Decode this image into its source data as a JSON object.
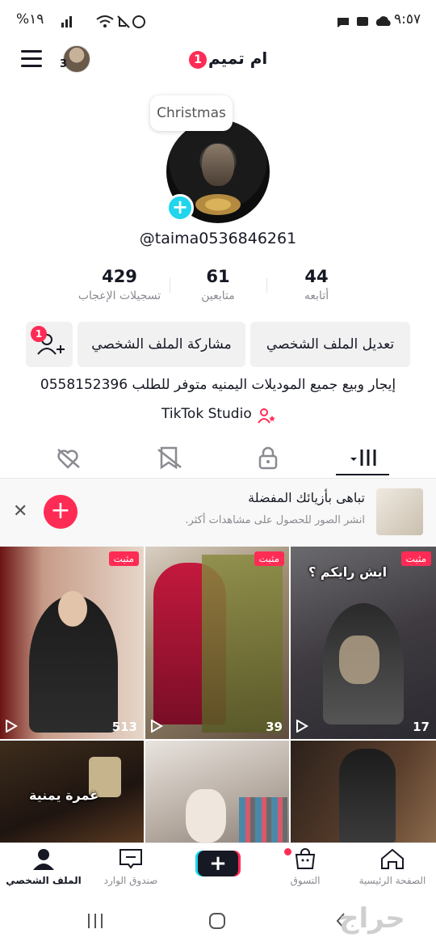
{
  "status_bar": {
    "time": "٩:٥٧",
    "battery": "%١٩"
  },
  "header": {
    "title": "ام تميم",
    "title_badge": "1",
    "avatar_count": "3"
  },
  "profile": {
    "note": "Christmas",
    "handle": "@taima0536846261",
    "stats": [
      {
        "value": "44",
        "label": "أتابعه"
      },
      {
        "value": "61",
        "label": "متابعين"
      },
      {
        "value": "429",
        "label": "تسجيلات الإعجاب"
      }
    ],
    "edit_button": "تعديل الملف الشخصي",
    "share_button": "مشاركة الملف الشخصي",
    "add_friend_badge": "1",
    "bio": "إيجار وبيع جميع الموديلات اليمنيه متوفر للطلب 0558152396",
    "studio_link": "TikTok Studio"
  },
  "tabs": [
    {
      "icon": "grid-icon",
      "active": true
    },
    {
      "icon": "lock-icon",
      "active": false
    },
    {
      "icon": "repost-icon",
      "active": false
    },
    {
      "icon": "liked-icon",
      "active": false
    }
  ],
  "promo": {
    "title": "تباهى بأزيائك المفضلة",
    "subtitle": "انشر الصور للحصول على مشاهدات أكثر."
  },
  "videos": [
    {
      "pinned_label": "مثبت",
      "views": "17",
      "overlay": "ايش رايكم ؟"
    },
    {
      "pinned_label": "مثبت",
      "views": "39",
      "overlay": ""
    },
    {
      "pinned_label": "مثبت",
      "views": "513",
      "overlay": ""
    },
    {
      "pinned_label": "",
      "views": "",
      "overlay": ""
    },
    {
      "pinned_label": "",
      "views": "",
      "overlay": ""
    },
    {
      "pinned_label": "",
      "views": "",
      "overlay": "غمرة يمنية"
    }
  ],
  "bottom_nav": {
    "home": "الصفحة الرئيسية",
    "shop": "التسوق",
    "create": "+",
    "inbox": "صندوق الوارد",
    "profile": "الملف الشخصي"
  },
  "watermark": "حراج",
  "colors": {
    "accent": "#fe2c55",
    "cyan": "#20d5ec",
    "text": "#161823",
    "muted": "#8a8b91"
  }
}
